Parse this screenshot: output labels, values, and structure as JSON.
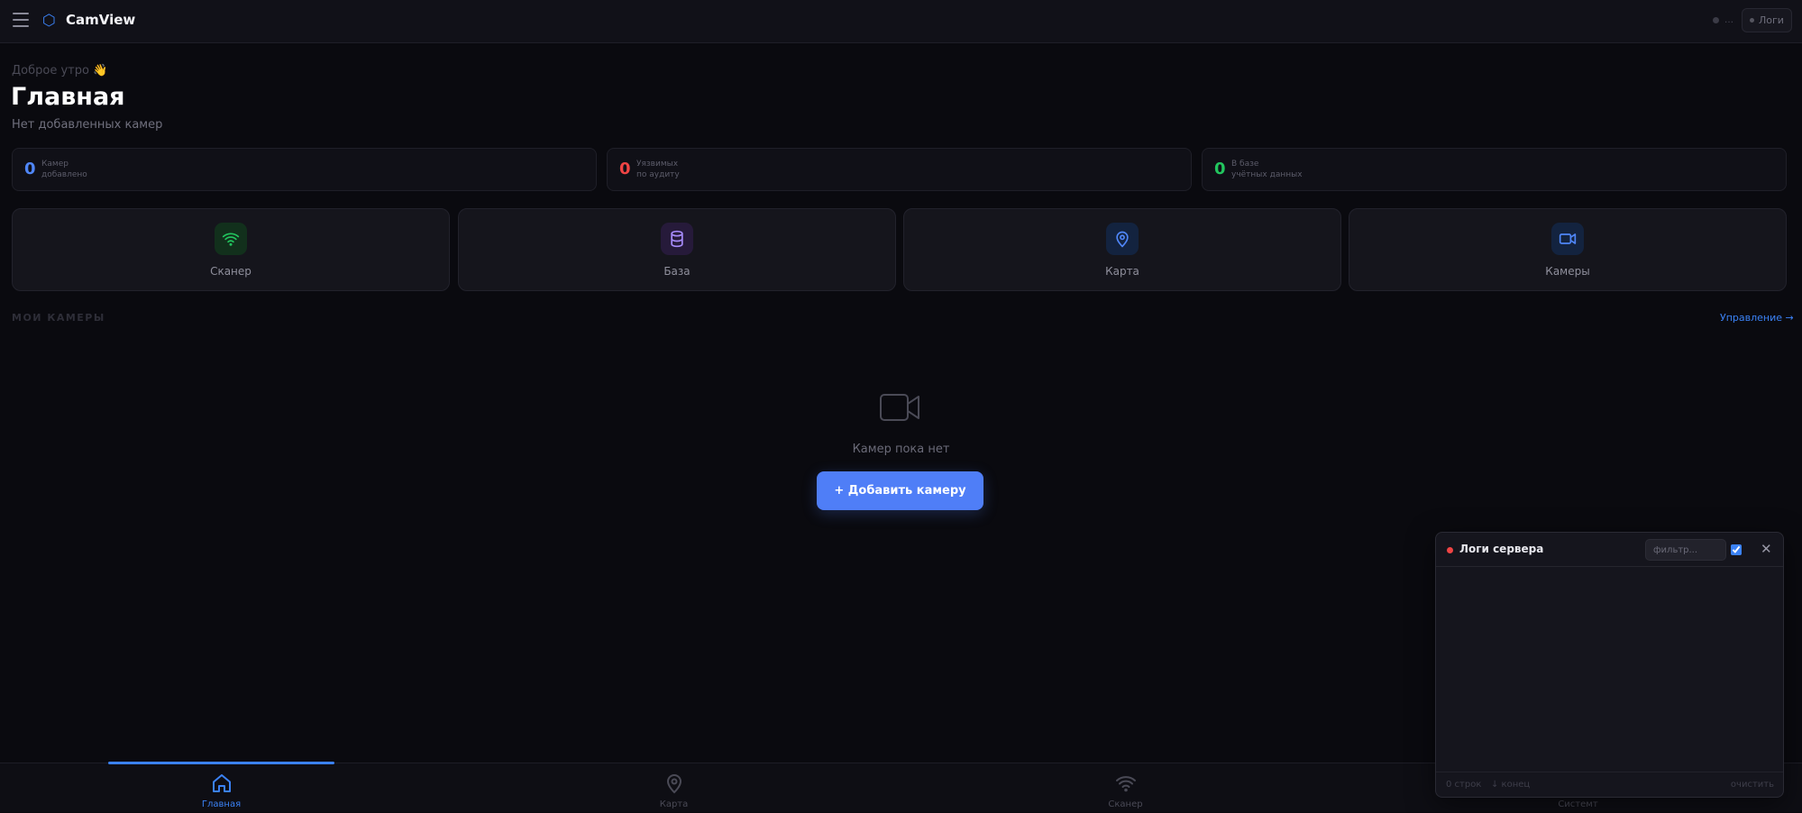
{
  "app": {
    "title": "CamView",
    "logo_glyph": "⬡",
    "accent": "#3b82f6"
  },
  "header": {
    "logs_label": "Логи"
  },
  "greeting": "Доброе утро 👋",
  "page_title": "Главная",
  "page_subtitle": "Нет добавленных камер",
  "stats": [
    {
      "value": "0",
      "line1": "Камер",
      "line2": "добавлено",
      "color": "#4f86f7"
    },
    {
      "value": "0",
      "line1": "Уязвимых",
      "line2": "по аудиту",
      "color": "#ef4444"
    },
    {
      "value": "0",
      "line1": "В базе",
      "line2": "учётных данных",
      "color": "#22c55e"
    }
  ],
  "quick_actions": [
    {
      "label": "Сканер",
      "icon": "wifi-icon"
    },
    {
      "label": "База",
      "icon": "database-icon"
    },
    {
      "label": "Карта",
      "icon": "map-pin-icon"
    },
    {
      "label": "Камеры",
      "icon": "video-icon"
    }
  ],
  "cameras_section": {
    "label": "МОИ КАМЕРЫ",
    "manage_label": "Управление →",
    "empty_text": "Камер пока нет",
    "add_button": "+ Добавить камеру"
  },
  "bottom_nav": [
    {
      "label": "Главная",
      "icon": "home-icon",
      "active": true
    },
    {
      "label": "Карта",
      "icon": "map-pin-icon",
      "active": false
    },
    {
      "label": "Сканер",
      "icon": "wifi-icon",
      "active": false
    },
    {
      "label": "Системт",
      "icon": "system-icon",
      "active": false
    }
  ],
  "logs_panel": {
    "title": "Логи сервера",
    "filter_placeholder": "фильтр...",
    "autoscroll_checked": true,
    "rows_count": "0 строк",
    "end_label": "↓ конец",
    "clear_label": "очистить"
  }
}
